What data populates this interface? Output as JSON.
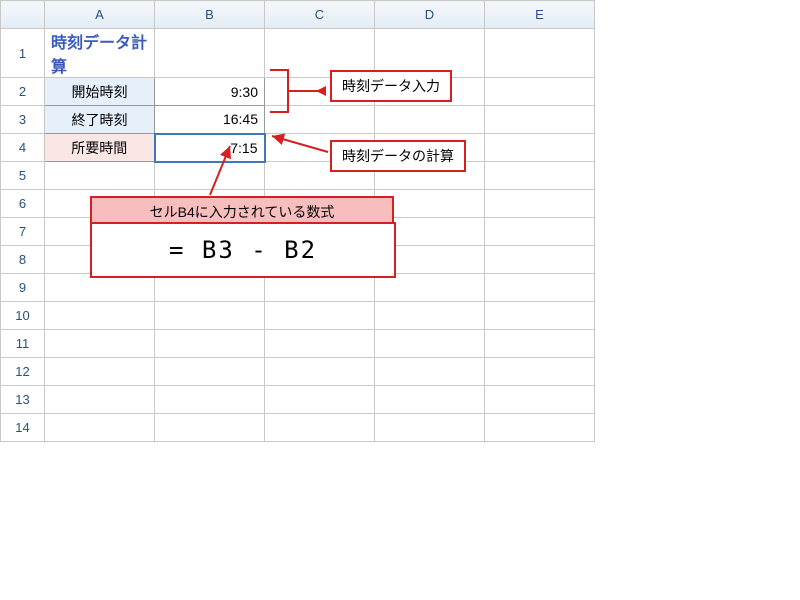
{
  "columns": [
    "A",
    "B",
    "C",
    "D",
    "E"
  ],
  "rows": [
    "1",
    "2",
    "3",
    "4",
    "5",
    "6",
    "7",
    "8",
    "9",
    "10",
    "11",
    "12",
    "13",
    "14"
  ],
  "title": "時刻データ計算",
  "cells": {
    "A2": "開始時刻",
    "A3": "終了時刻",
    "A4": "所要時間",
    "B2": "9:30",
    "B3": "16:45",
    "B4": "7:15"
  },
  "annotations": {
    "input_label": "時刻データ入力",
    "calc_label": "時刻データの計算",
    "formula_caption": "セルB4に入力されている数式",
    "formula": "= B3 - B2"
  }
}
